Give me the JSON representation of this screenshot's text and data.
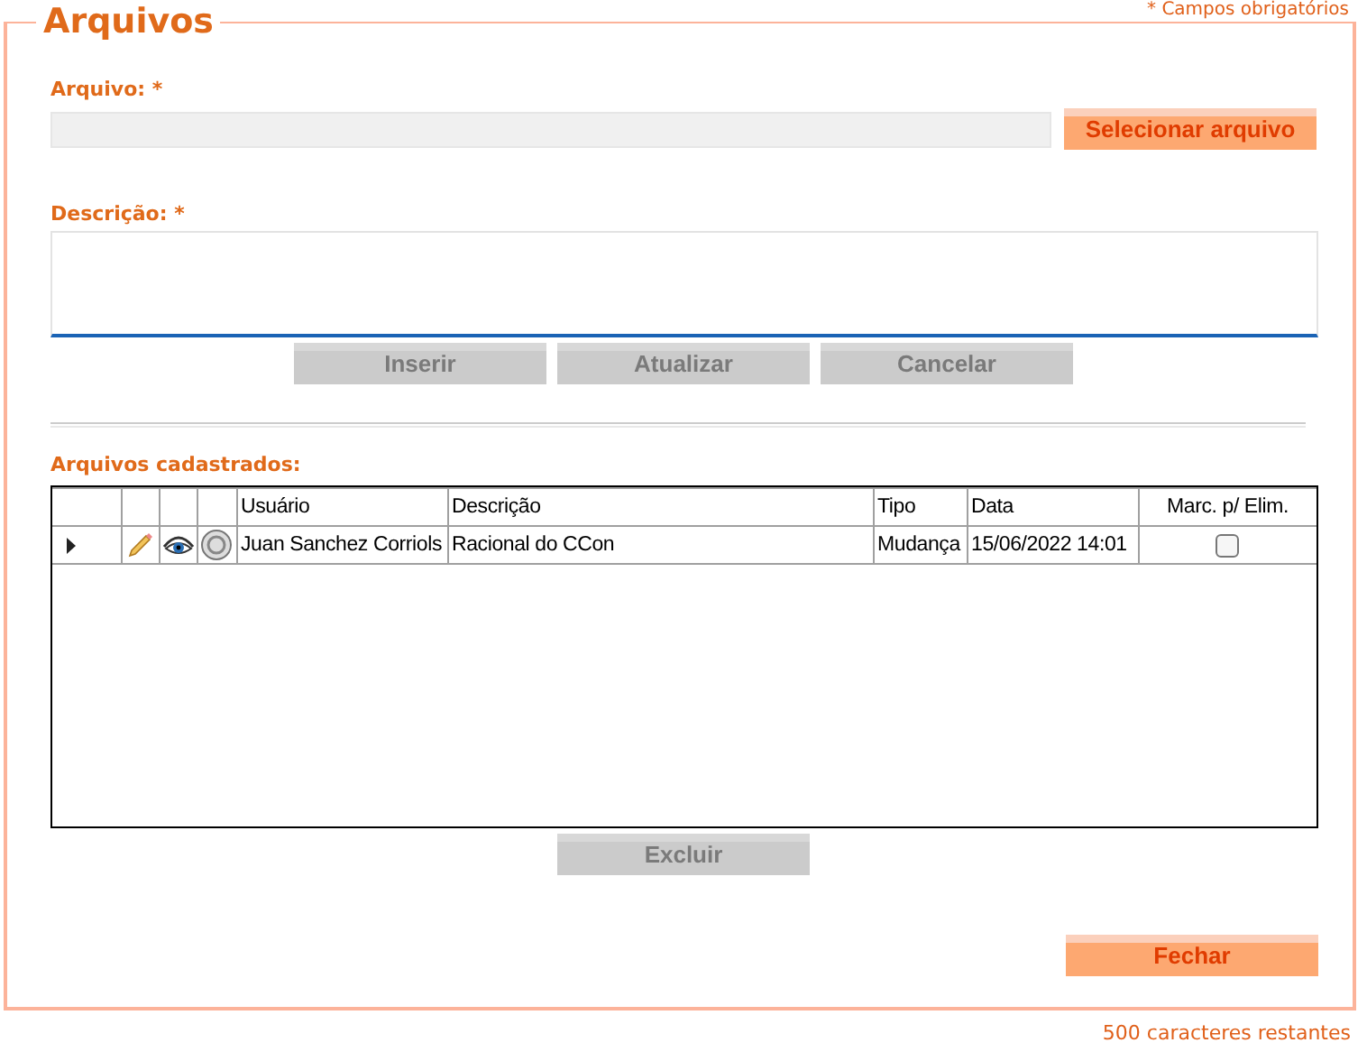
{
  "panel": {
    "title": "Arquivos",
    "required_note": "* Campos obrigatórios"
  },
  "file_field": {
    "label": "Arquivo: *",
    "button": {
      "label": "Selecionar arquivo",
      "disabled": false
    }
  },
  "description_field": {
    "label": "Descrição: *",
    "focused": true
  },
  "actions": [
    {
      "label": "Inserir",
      "disabled": true
    },
    {
      "label": "Atualizar",
      "disabled": true
    },
    {
      "label": "Cancelar",
      "disabled": true
    }
  ],
  "table": {
    "label": "Arquivos cadastrados:",
    "columns": [
      "Usuário",
      "Descrição",
      "Tipo",
      "Data",
      "Marc. p/ Elim."
    ],
    "rows": [
      {
        "selected": true,
        "user": "Juan Sanchez Corriols",
        "description": "Racional do CCon",
        "type": "Mudança",
        "date": "15/06/2022 14:01",
        "checked": false
      }
    ]
  },
  "delete_button": {
    "label": "Excluir",
    "disabled": true
  },
  "close_button": {
    "label": "Fechar",
    "disabled": false
  },
  "counter": "500  caracteres restantes"
}
